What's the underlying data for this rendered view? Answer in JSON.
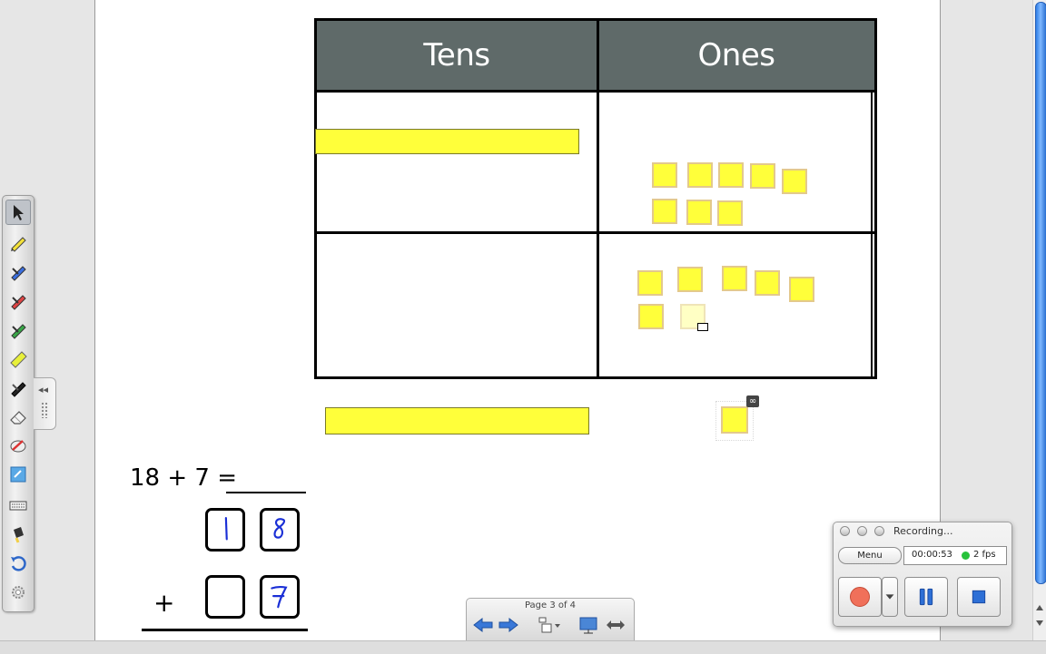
{
  "table": {
    "headers": [
      "Tens",
      "Ones"
    ]
  },
  "equation": {
    "text": "18 + 7 =",
    "top_digits": [
      "1",
      "8"
    ],
    "bottom_digits": [
      "",
      "7"
    ],
    "operator": "+"
  },
  "page_navigator": {
    "label": "Page 3 of 4"
  },
  "recorder": {
    "title": "Recording...",
    "menu_label": "Menu",
    "elapsed": "00:00:53",
    "fps": "2 fps",
    "status_color": "#27c23b"
  },
  "toolbar": {
    "tools": [
      "select-arrow-icon",
      "pen-yellow-icon",
      "pen-blue-icon",
      "pen-red-icon",
      "pen-green-icon",
      "highlighter-icon",
      "pen-black-icon",
      "eraser-icon",
      "shape-recognition-icon",
      "note-icon",
      "keyboard-icon",
      "fill-icon",
      "undo-icon",
      "settings-icon"
    ]
  },
  "colors": {
    "header_bg": "#5f6a69",
    "block_fill": "#ffff3a",
    "ink_blue": "#1a2fd6"
  }
}
